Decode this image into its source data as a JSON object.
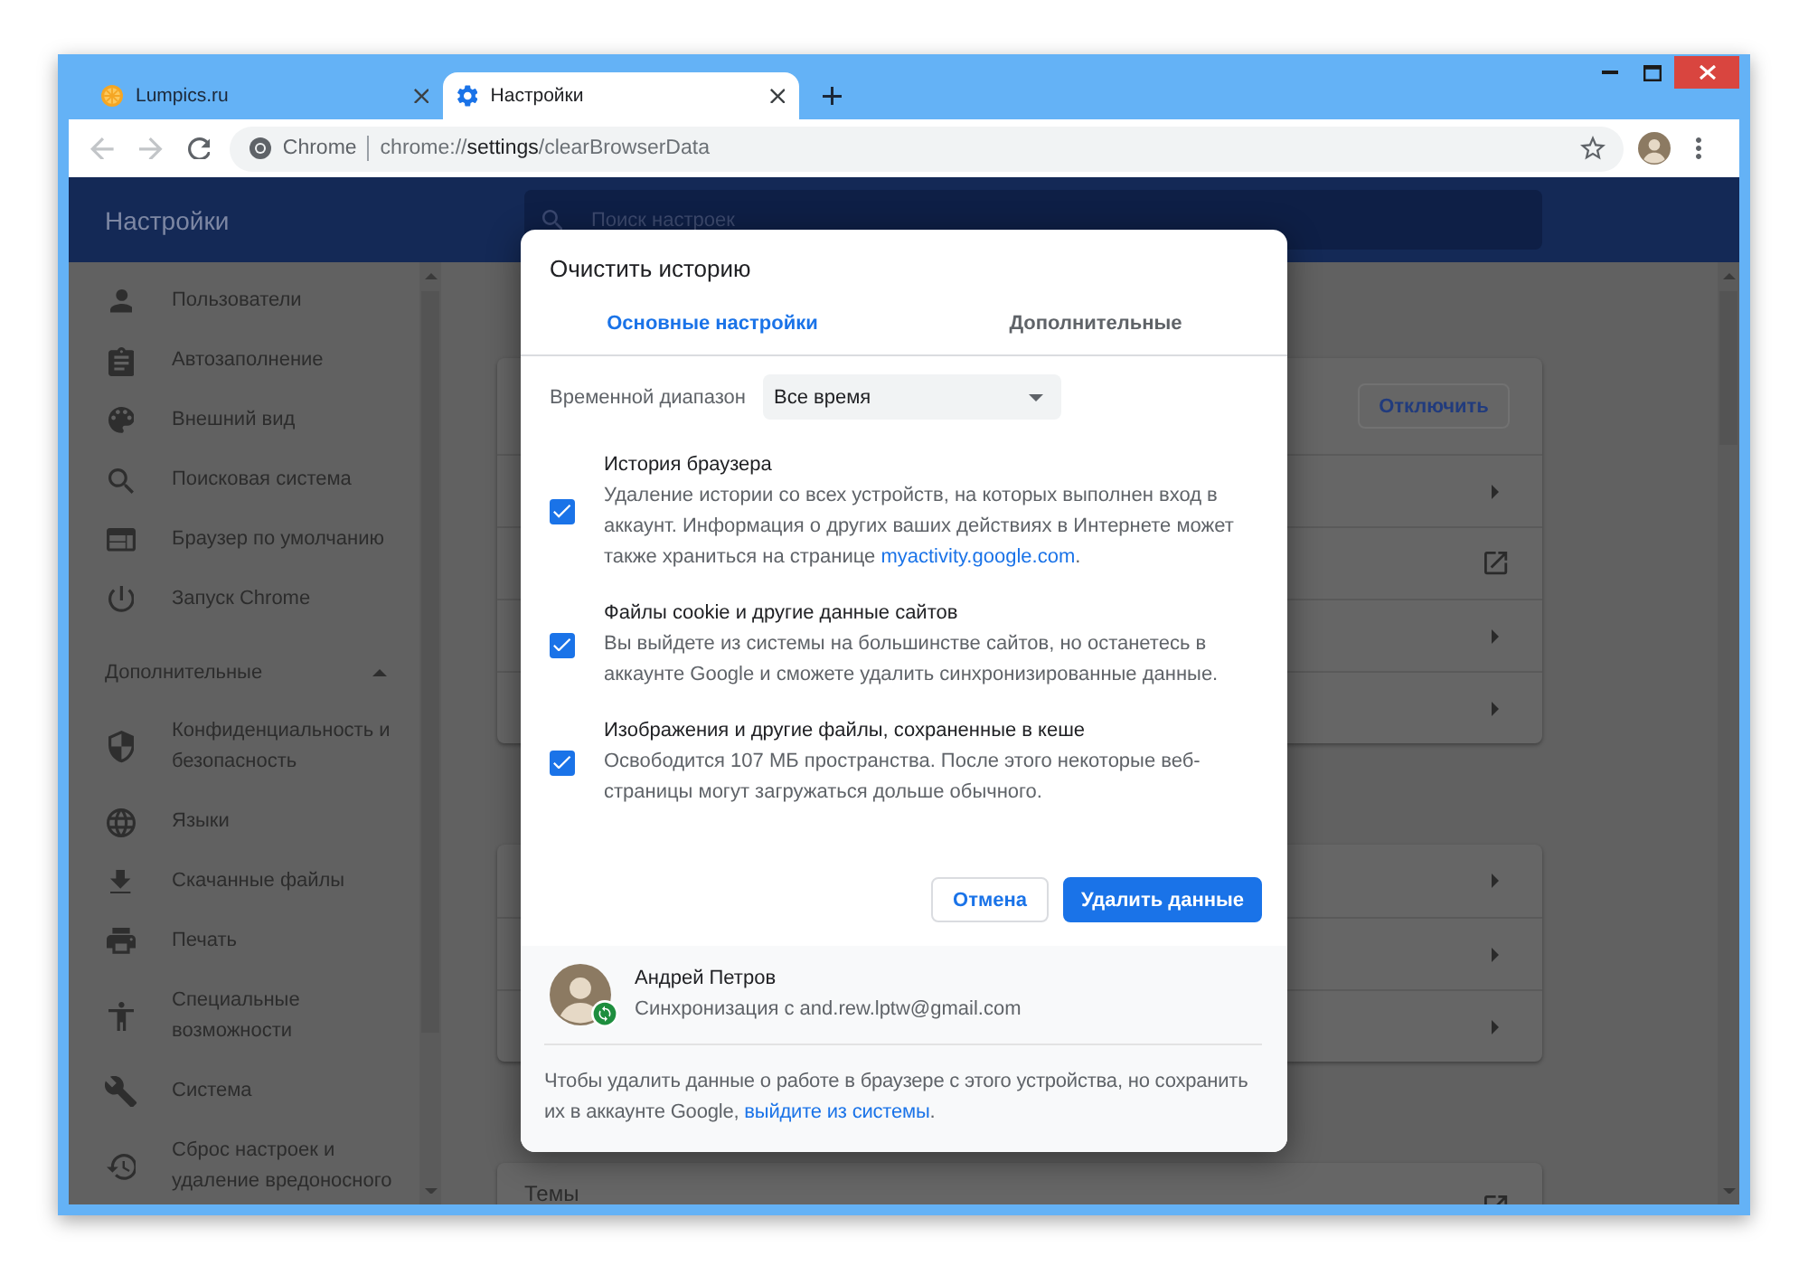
{
  "browser": {
    "tabs": [
      {
        "title": "Lumpics.ru",
        "selected": false
      },
      {
        "title": "Настройки",
        "selected": true
      }
    ],
    "nav_buttons": [
      {
        "disabled": true
      },
      {
        "disabled": true
      },
      {
        "disabled": false
      }
    ],
    "omnibox": {
      "site_label": "Chrome",
      "url": {
        "scheme": "chrome://",
        "host": "settings",
        "path": "/clearBrowserData"
      }
    }
  },
  "settings": {
    "title": "Настройки",
    "search_placeholder": "Поиск настроек",
    "sidebar": {
      "items": [
        {
          "label": "Пользователи",
          "selected": false
        },
        {
          "label": "Автозаполнение",
          "selected": false
        },
        {
          "label": "Внешний вид",
          "selected": false
        },
        {
          "label": "Поисковая система",
          "selected": false
        },
        {
          "label": "Браузер по умолчанию",
          "selected": false
        },
        {
          "label": "Запуск Chrome",
          "selected": false
        }
      ],
      "advanced": {
        "label": "Дополнительные",
        "expanded": true,
        "items": [
          {
            "label": "Конфиденциальность и безопасность",
            "selected": false
          },
          {
            "label": "Языки",
            "selected": false
          },
          {
            "label": "Скачанные файлы",
            "selected": false
          },
          {
            "label": "Печать",
            "selected": false
          },
          {
            "label": "Специальные возможности",
            "selected": false
          },
          {
            "label": "Система",
            "selected": false
          },
          {
            "label": "Сброс настроек и удаление вредоносного",
            "selected": false
          }
        ]
      }
    },
    "cards": [
      {
        "rows": [
          {
            "kind": "button",
            "button": "Отключить"
          },
          {
            "kind": "submenu"
          },
          {
            "kind": "external"
          },
          {
            "kind": "submenu"
          },
          {
            "kind": "submenu"
          }
        ]
      },
      {
        "rows": [
          {
            "kind": "submenu"
          },
          {
            "kind": "submenu"
          },
          {
            "kind": "submenu"
          }
        ]
      },
      {
        "rows": [
          {
            "kind": "external",
            "label": "Темы"
          }
        ]
      }
    ]
  },
  "dialog": {
    "title": "Очистить историю",
    "tabs": [
      {
        "label": "Основные настройки",
        "selected": true
      },
      {
        "label": "Дополнительные",
        "selected": false
      }
    ],
    "time_range": {
      "label": "Временной диапазон",
      "value": "Все время"
    },
    "options": [
      {
        "title": "История браузера",
        "description": "Удаление истории со всех устройств, на которых выполнен вход в аккаунт. Информация о других ваших действиях в Интернете может также храниться на странице",
        "link": "myactivity.google.com",
        "description_end": ".",
        "checked": true
      },
      {
        "title": "Файлы cookie и другие данные сайтов",
        "description": "Вы выйдете из системы на большинстве сайтов, но останетесь в аккаунте Google и сможете удалить синхронизированные данные.",
        "checked": true
      },
      {
        "title": "Изображения и другие файлы, сохраненные в кеше",
        "description": "Освободится 107 МБ пространства. После этого некоторые веб-страницы могут загружаться дольше обычного.",
        "checked": true
      }
    ],
    "buttons": [
      {
        "kind": "secondary",
        "label": "Отмена"
      },
      {
        "kind": "primary",
        "label": "Удалить данные"
      }
    ],
    "account": {
      "name": "Андрей Петров",
      "sync_status": "Синхронизация с and.rew.lptw@gmail.com"
    },
    "note": {
      "text": "Чтобы удалить данные о работе в браузере с этого устройства, но сохранить их в аккаунте Google,",
      "link": "выйдите из системы",
      "text_end": "."
    }
  }
}
